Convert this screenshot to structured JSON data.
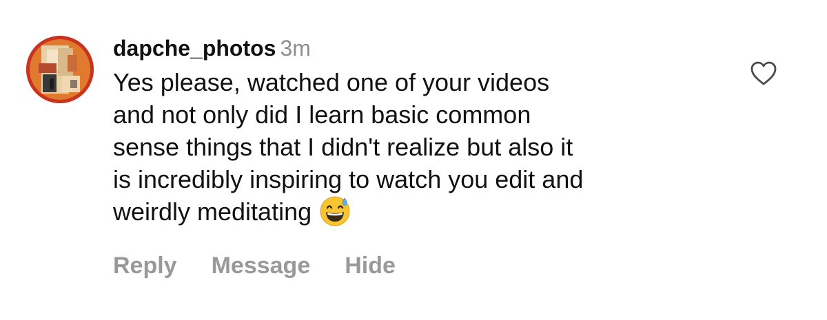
{
  "comment": {
    "username": "dapche_photos",
    "timestamp": "3m",
    "text_lines": [
      "Yes please, watched one of your videos",
      "and not only did I learn basic common",
      "sense things that I didn't realize but also it",
      "is incredibly inspiring to watch you edit and",
      "weirdly meditating"
    ],
    "emoji": "grinning-face-with-sweat-emoji",
    "avatar_icon": "profile-picture-avatar"
  },
  "actions": {
    "reply_label": "Reply",
    "message_label": "Message",
    "hide_label": "Hide"
  },
  "like": {
    "icon": "heart-outline-icon"
  },
  "colors": {
    "text": "#111111",
    "muted": "#8e8e8e",
    "action": "#999999",
    "avatar_ring": "#c9331f"
  }
}
